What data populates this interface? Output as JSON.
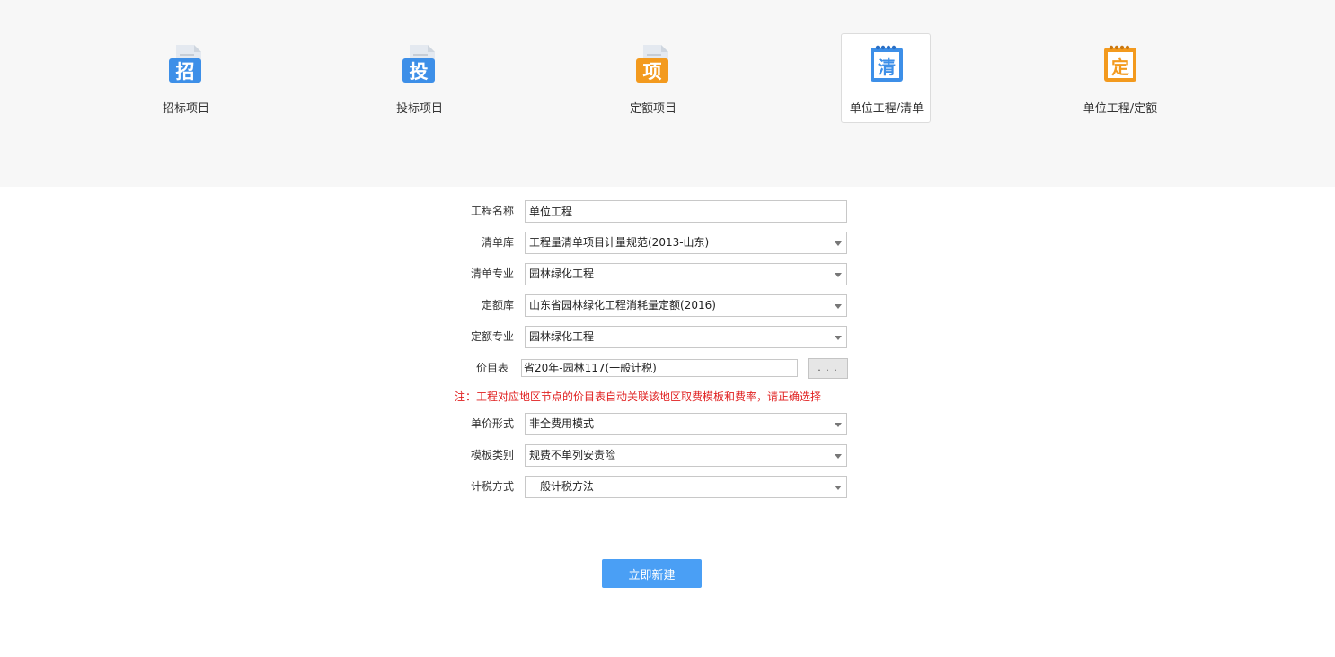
{
  "project_types": [
    {
      "label": "招标项目",
      "glyph": "招",
      "color": "#3d8fe8",
      "icon": "bid-invite-document-icon"
    },
    {
      "label": "投标项目",
      "glyph": "投",
      "color": "#3d8fe8",
      "icon": "bid-submit-document-icon"
    },
    {
      "label": "定额项目",
      "glyph": "项",
      "color": "#f39a1e",
      "icon": "quota-project-document-icon"
    },
    {
      "label": "单位工程/清单",
      "glyph": "清",
      "color": "#3d8fe8",
      "icon": "bill-notebook-icon"
    },
    {
      "label": "单位工程/定额",
      "glyph": "定",
      "color": "#f39a1e",
      "icon": "quota-notebook-icon"
    }
  ],
  "selected_type": "单位工程/清单",
  "form": {
    "project_name": {
      "label": "工程名称",
      "value": "单位工程"
    },
    "bill_library": {
      "label": "清单库",
      "value": "工程量清单项目计量规范(2013-山东)"
    },
    "bill_specialty": {
      "label": "清单专业",
      "value": "园林绿化工程"
    },
    "quota_library": {
      "label": "定额库",
      "value": "山东省园林绿化工程消耗量定额(2016)"
    },
    "quota_specialty": {
      "label": "定额专业",
      "value": "园林绿化工程"
    },
    "price_table": {
      "label": "价目表",
      "value": "省20年-园林117(一般计税)",
      "browse_label": ". . ."
    },
    "note": "注：工程对应地区节点的价目表自动关联该地区取费模板和费率，请正确选择",
    "unit_price_form": {
      "label": "单价形式",
      "value": "非全费用模式"
    },
    "template_category": {
      "label": "模板类别",
      "value": "规费不单列安责险"
    },
    "tax_method": {
      "label": "计税方式",
      "value": "一般计税方法"
    }
  },
  "create_button": "立即新建",
  "colors": {
    "accent": "#4a9ff5",
    "note": "#e02020",
    "blue_icon": "#3d8fe8",
    "orange_icon": "#f39a1e"
  }
}
